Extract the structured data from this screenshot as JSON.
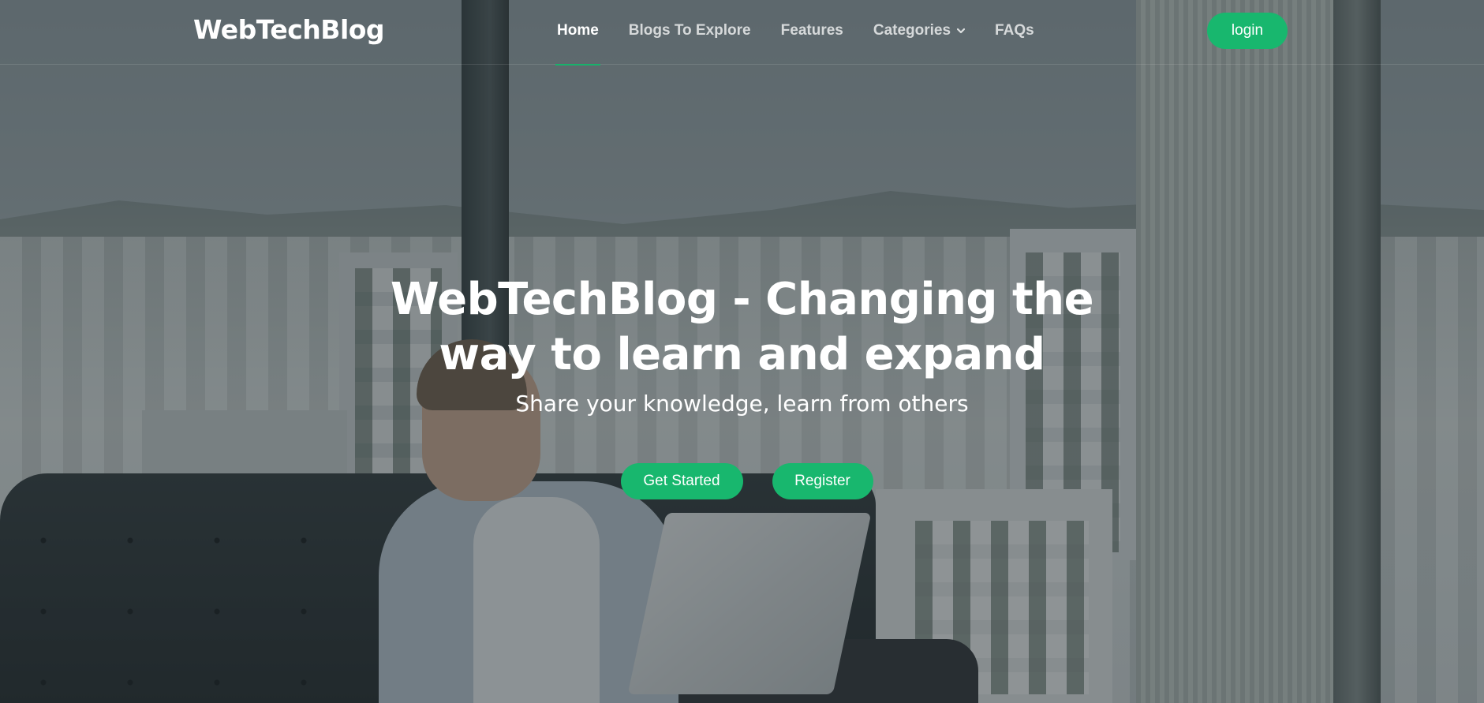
{
  "brand": {
    "name": "WebTechBlog",
    "accent_color": "#18b76e"
  },
  "nav": {
    "items": [
      {
        "label": "Home",
        "active": true
      },
      {
        "label": "Blogs To Explore",
        "active": false
      },
      {
        "label": "Features",
        "active": false
      },
      {
        "label": "Categories",
        "active": false,
        "icon": "chevron-down-icon"
      },
      {
        "label": "FAQs",
        "active": false
      }
    ],
    "login_label": "login"
  },
  "hero": {
    "title": "WebTechBlog - Changing the way to learn and expand",
    "subtitle": "Share your knowledge, learn from others",
    "primary_cta": "Get Started",
    "secondary_cta": "Register"
  }
}
